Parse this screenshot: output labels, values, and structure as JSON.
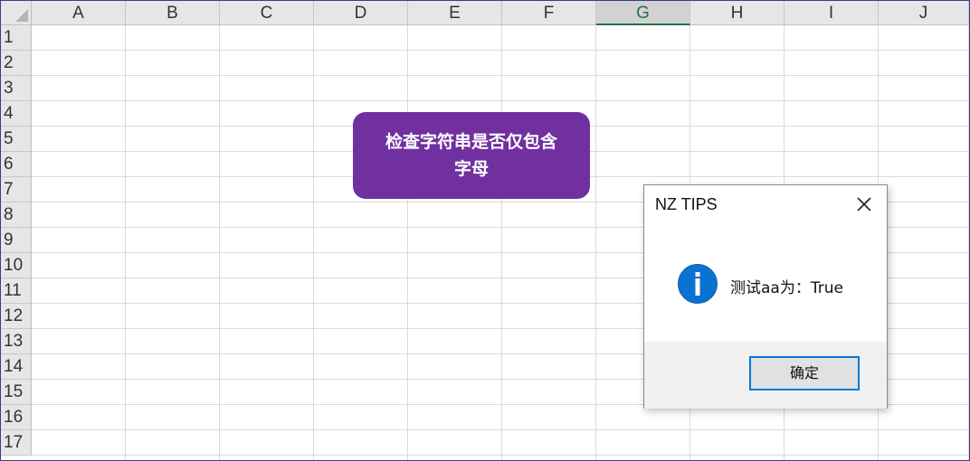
{
  "sheet": {
    "columns": [
      "A",
      "B",
      "C",
      "D",
      "E",
      "F",
      "G",
      "H",
      "I",
      "J"
    ],
    "selected_column": "G",
    "rows": [
      "1",
      "2",
      "3",
      "4",
      "5",
      "6",
      "7",
      "8",
      "9",
      "10",
      "11",
      "12",
      "13",
      "14",
      "15",
      "16",
      "17"
    ]
  },
  "shape": {
    "line1": "检查字符串是否仅包含",
    "line2": "字母",
    "fill_color": "#7030a0"
  },
  "dialog": {
    "title": "NZ TIPS",
    "icon": "info-icon",
    "message": "测试aa为：True",
    "ok_label": "确定",
    "accent_color": "#0078d7"
  }
}
